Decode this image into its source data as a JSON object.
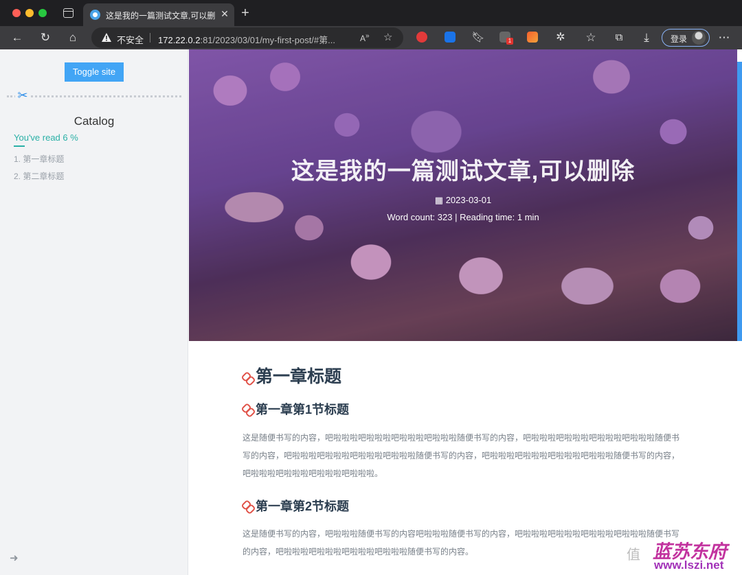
{
  "browser": {
    "tab_title": "这是我的一篇测试文章,可以删除",
    "tab_close": "✕",
    "new_tab": "+",
    "address": {
      "security_label": "不安全",
      "host": "172.22.0.2",
      "path": ":81/2023/03/01/my-first-post/#第..."
    },
    "login_label": "登录",
    "extension_badge": "1"
  },
  "sidebar": {
    "toggle_label": "Toggle site",
    "catalog_title": "Catalog",
    "read_progress": "You've read  6  %",
    "catalog_items": [
      {
        "label": "1. 第一章标题"
      },
      {
        "label": "2. 第二章标题"
      }
    ]
  },
  "post": {
    "title": "这是我的一篇测试文章,可以删除",
    "date": "2023-03-01",
    "meta": "Word count: 323 | Reading time: 1 min",
    "sections": [
      {
        "heading": "第一章标题"
      },
      {
        "heading": "第一章第1节标题",
        "body": "这是随便书写的内容，吧啦啦啦吧啦啦啦吧啦啦啦吧啦啦啦随便书写的内容，吧啦啦啦吧啦啦啦吧啦啦啦吧啦啦啦随便书写的内容，吧啦啦啦吧啦啦啦吧啦啦啦吧啦啦啦随便书写的内容，吧啦啦啦吧啦啦啦吧啦啦啦吧啦啦啦随便书写的内容，吧啦啦啦吧啦啦啦吧啦啦啦吧啦啦啦。"
      },
      {
        "heading": "第一章第2节标题",
        "body": "这是随便书写的内容，吧啦啦啦随便书写的内容吧啦啦啦随便书写的内容，吧啦啦啦吧啦啦啦吧啦啦啦吧啦啦啦随便书写的内容，吧啦啦啦吧啦啦啦吧啦啦啦吧啦啦啦随便书写的内容。"
      }
    ]
  },
  "watermark": {
    "char": "值",
    "logo": "蓝苏东府",
    "url": "www.lszi.net"
  },
  "colors": {
    "accent_blue": "#42a5f5",
    "progress_teal": "#2ab0a6",
    "heading": "#2c3e50",
    "anchor_red": "#e05046"
  },
  "icons": {
    "back": "back-arrow-icon",
    "reload": "reload-icon",
    "home": "home-icon",
    "warning": "warning-icon",
    "scissors": "scissors-icon",
    "calendar": "calendar-icon",
    "anchor": "link-icon"
  }
}
